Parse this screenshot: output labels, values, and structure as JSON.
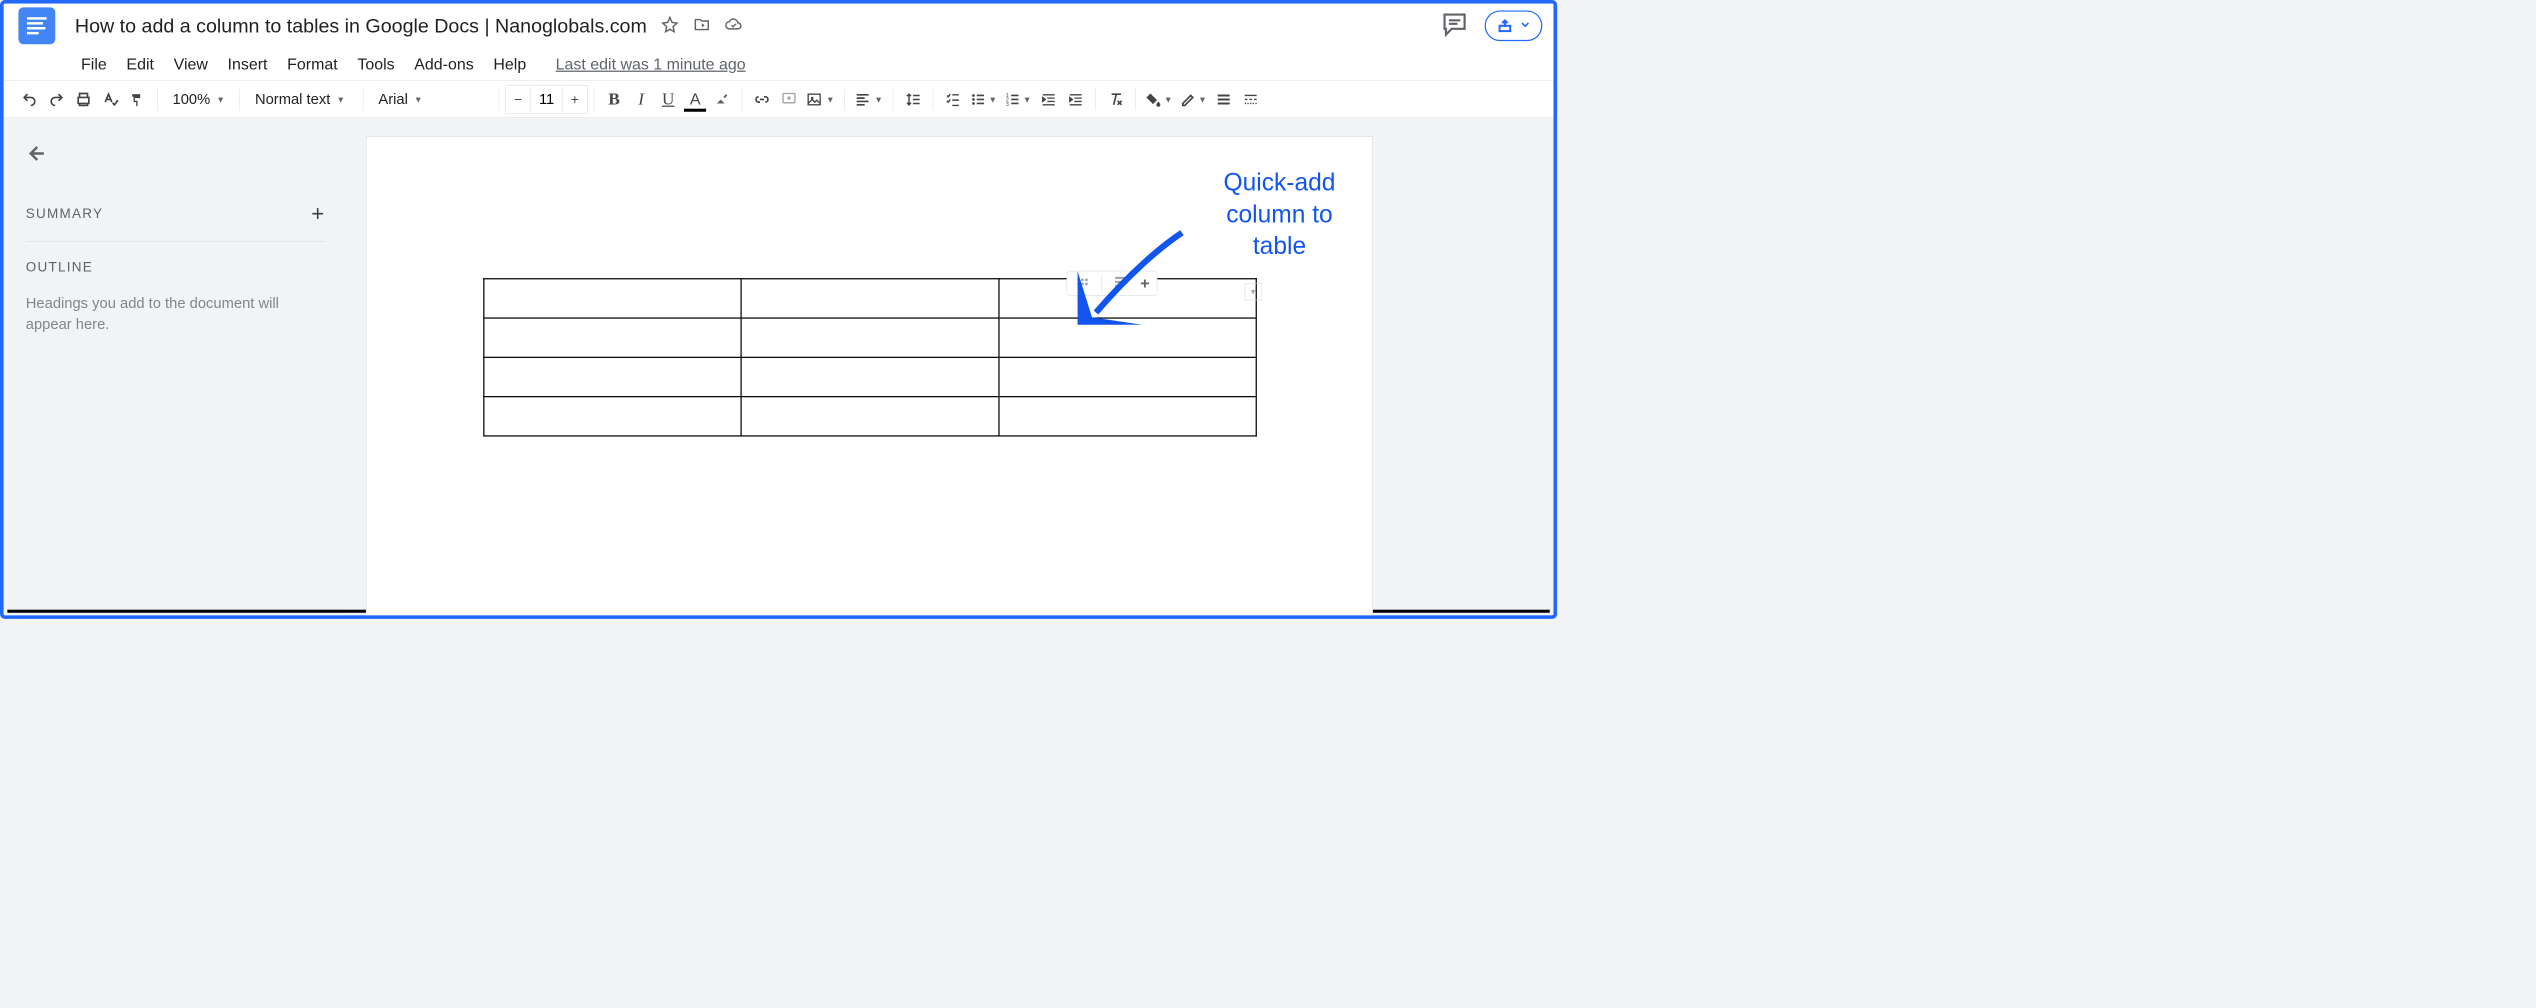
{
  "document_title": "How to add a column to tables in Google Docs | Nanoglobals.com",
  "menu": [
    "File",
    "Edit",
    "View",
    "Insert",
    "Format",
    "Tools",
    "Add-ons",
    "Help"
  ],
  "last_edit": "Last edit was 1 minute ago",
  "toolbar": {
    "zoom": "100%",
    "style": "Normal text",
    "font": "Arial",
    "font_size": "11"
  },
  "outline": {
    "summary_label": "SUMMARY",
    "outline_label": "OUTLINE",
    "hint": "Headings you add to the document will appear here."
  },
  "annotation": {
    "line1": "Quick-add",
    "line2": "column to",
    "line3": "table"
  },
  "table": {
    "rows": 4,
    "cols": 3
  }
}
